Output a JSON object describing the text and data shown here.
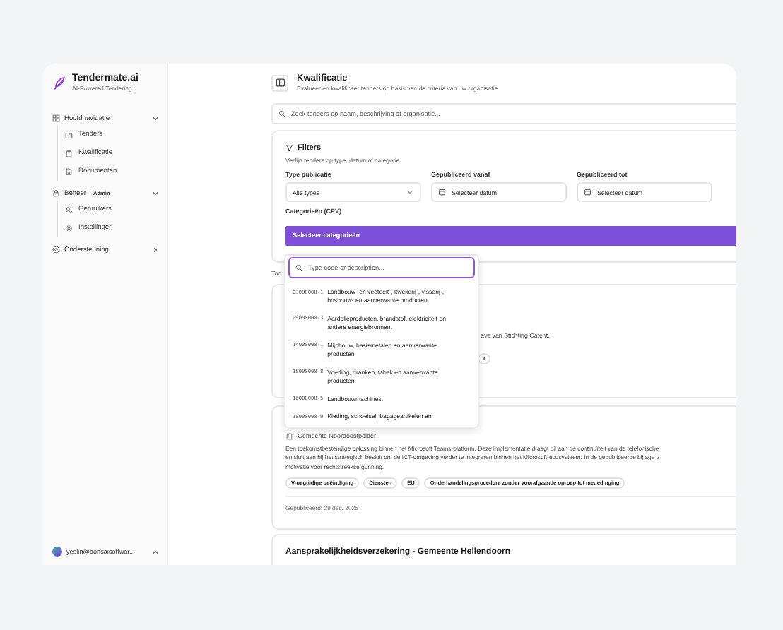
{
  "brand": {
    "name": "Tendermate.ai",
    "tagline": "AI-Powered Tendering"
  },
  "nav": [
    {
      "label": "Hoofdnavigatie",
      "expanded": true,
      "children": [
        {
          "label": "Tenders"
        },
        {
          "label": "Kwalificatie"
        },
        {
          "label": "Documenten"
        }
      ]
    },
    {
      "label": "Beheer",
      "expanded": true,
      "badge": "Admin",
      "children": [
        {
          "label": "Gebruikers"
        },
        {
          "label": "Instellingen"
        }
      ]
    },
    {
      "label": "Ondersteuning",
      "expanded": false
    }
  ],
  "user": {
    "email": "yeslin@bonsaisoftwar..."
  },
  "page": {
    "title": "Kwalificatie",
    "subtitle": "Evalueer en kwalificeer tenders op basis van de criteria van uw organisatie"
  },
  "search": {
    "placeholder": "Zoek tenders op naam, beschrijving of organisatie..."
  },
  "filters": {
    "title": "Filters",
    "subtitle": "Verfijn tenders op type, datum of categorie",
    "fields": [
      {
        "kind": "select",
        "label": "Type publicatie",
        "value": "Alle types"
      },
      {
        "kind": "date",
        "label": "Gepubliceerd vanaf",
        "value": "Selecteer datum"
      },
      {
        "kind": "date",
        "label": "Gepubliceerd tot",
        "value": "Selecteer datum"
      }
    ],
    "category_label": "Categorieën (CPV)",
    "category_button": "Selecteer categorieën"
  },
  "cpv_dropdown": {
    "placeholder": "Type code or description...",
    "options": [
      {
        "code": "03000000-1",
        "description": "Landbouw- en veeteelt-, kwekerij-, visserij-, bosbouw- en aanverwante producten."
      },
      {
        "code": "09000000-3",
        "description": "Aardolieproducten, brandstof, elektriciteit en andere energiebronnen."
      },
      {
        "code": "14000000-1",
        "description": "Mijnbouw, basismetalen en aanverwante producten."
      },
      {
        "code": "15000000-8",
        "description": "Voeding, dranken, tabak en aanverwante producten."
      },
      {
        "code": "16000000-5",
        "description": "Landbouwmachines."
      },
      {
        "code": "18000000-9",
        "description": "Kleding, schoeisel, bagageartikelen en"
      }
    ]
  },
  "results_label": "Too",
  "tenders": [
    {
      "description_lines": [
        "ave van Stichting Catent."
      ],
      "tags": [
        "r"
      ]
    },
    {
      "organization": "Gemeente Noordoostpolder",
      "description_lines": [
        "Een toekomstbestendige oplossing binnen het Microsoft Teams-platform. Deze implementatie draagt bij aan de continuïteit van de telefonische",
        "en sluit aan bij het strategisch besluit om de ICT-omgeving verder te integreren binnen het Microsoft-ecosysteem. In de gepubliceerde bijlage v",
        "motivatie voor rechtstreekse gunning."
      ],
      "tags": [
        "Vroegtijdige beëindiging",
        "Diensten",
        "EU",
        "Onderhandelingsprocedure zonder voorafgaande oproep tot mededinging"
      ],
      "published": "Gepubliceerd: 29 dec. 2025"
    },
    {
      "title": "Aansprakelijkheidsverzekering - Gemeente Hellendoorn"
    }
  ]
}
